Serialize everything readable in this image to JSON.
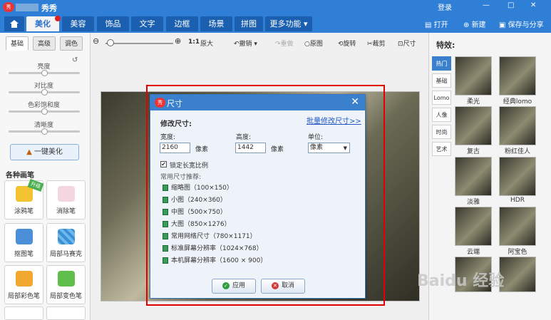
{
  "window": {
    "app_title": "秀秀",
    "login": "登录",
    "controls": [
      "—",
      "□",
      "✕"
    ]
  },
  "nav": {
    "tabs": [
      "美化",
      "美容",
      "饰品",
      "文字",
      "边框",
      "场景",
      "拼图",
      "更多功能"
    ],
    "open": "打开",
    "new": "新建",
    "save": "保存与分享"
  },
  "left": {
    "subtabs": [
      "基础",
      "高级",
      "调色"
    ],
    "sliders": [
      "亮度",
      "对比度",
      "色彩饱和度",
      "清晰度"
    ],
    "one_click": "一键美化",
    "section": "各种画笔",
    "tools": [
      "涂鸦笔",
      "消除笔",
      "抠图笔",
      "局部马赛克",
      "局部彩色笔",
      "局部变色笔"
    ],
    "new_badge": "升级"
  },
  "toolbar": {
    "ratio": "1:1",
    "original_size": "原大",
    "undo": "撤销",
    "redo": "重做",
    "original": "原图",
    "rotate": "旋转",
    "crop": "裁剪",
    "size": "尺寸"
  },
  "dialog": {
    "logo": "秀",
    "title": "尺寸",
    "close": "✕",
    "modify_size": "修改尺寸:",
    "batch_link": "批量修改尺寸>>",
    "width_label": "宽度:",
    "width_value": "2160",
    "height_label": "高度:",
    "height_value": "1442",
    "pixel_unit": "像素",
    "unit_label": "单位:",
    "unit_value": "像素",
    "lock_ratio": "锁定长宽比例",
    "lock_checked": true,
    "recommend": "常用尺寸推荐:",
    "presets": [
      "缩略图（100×150）",
      "小图（240×360）",
      "中图（500×750）",
      "大图（850×1276）",
      "常用网络尺寸（780×1171）",
      "标准屏幕分辨率（1024×768）",
      "本机屏幕分辨率（1600 × 900）"
    ],
    "apply": "应用",
    "cancel": "取消"
  },
  "right": {
    "heading": "特效:",
    "tabs": [
      "热门",
      "基础",
      "Lomo",
      "人像",
      "时尚",
      "艺术"
    ],
    "effects": [
      "柔光",
      "经典lomo",
      "复古",
      "粉红佳人",
      "淡雅",
      "HDR",
      "云端",
      "阿宝色"
    ],
    "watermark": "Baidu 经验"
  },
  "colors": {
    "title_bar": "#2f7fd6",
    "highlight": "#e00000",
    "dialog_header": "#3b80cd"
  }
}
